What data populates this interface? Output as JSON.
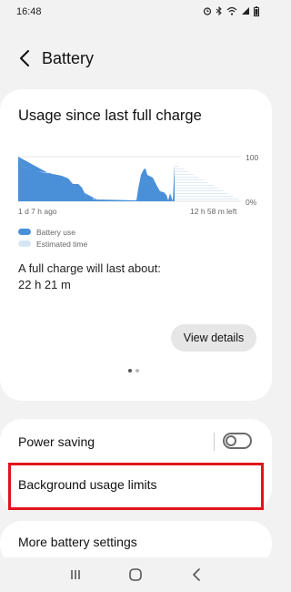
{
  "status_bar": {
    "time": "16:48",
    "icons": [
      "alarm-icon",
      "bluetooth-icon",
      "wifi-icon",
      "signal-icon",
      "battery-icon"
    ]
  },
  "header": {
    "title": "Battery"
  },
  "usage_card": {
    "title": "Usage since last full charge",
    "x_start_label": "1 d 7 h ago",
    "x_end_label": "12 h 58 m left",
    "y_top_label": "100",
    "y_bottom_label": "0%",
    "legend": [
      {
        "label": "Battery use",
        "color": "#4a90d9"
      },
      {
        "label": "Estimated time",
        "color": "#d7e6f5"
      }
    ],
    "full_charge_label": "A full charge will last about:",
    "full_charge_value": "22 h 21 m",
    "view_details_label": "View details",
    "page_dots": {
      "active": 0,
      "count": 2
    }
  },
  "settings": {
    "power_saving_label": "Power saving",
    "power_saving_on": false,
    "background_usage_label": "Background usage limits",
    "more_settings_label": "More battery settings"
  },
  "colors": {
    "accent": "#4a90d9",
    "estimated": "#d7e6f5",
    "highlight": "#e0141b"
  }
}
